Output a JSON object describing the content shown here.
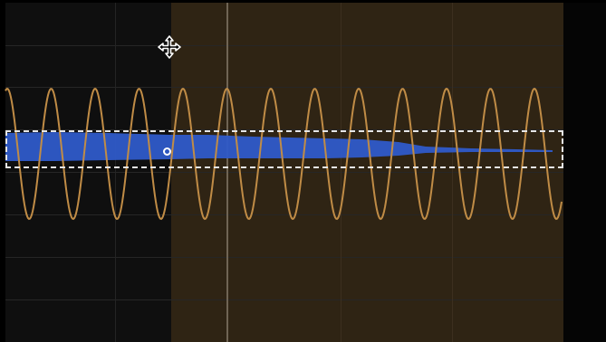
{
  "colors": {
    "background": "#000000",
    "grid_panel": "#0f0f0f",
    "selected_region": "#2f2414",
    "lfo_curve": "#c08c46",
    "waveform": "#2f5bc9",
    "selection_outline": "#e6e6e6",
    "playhead": "#6f6454"
  },
  "cursor": {
    "type": "move-cursor"
  },
  "clip": {
    "label": ""
  }
}
